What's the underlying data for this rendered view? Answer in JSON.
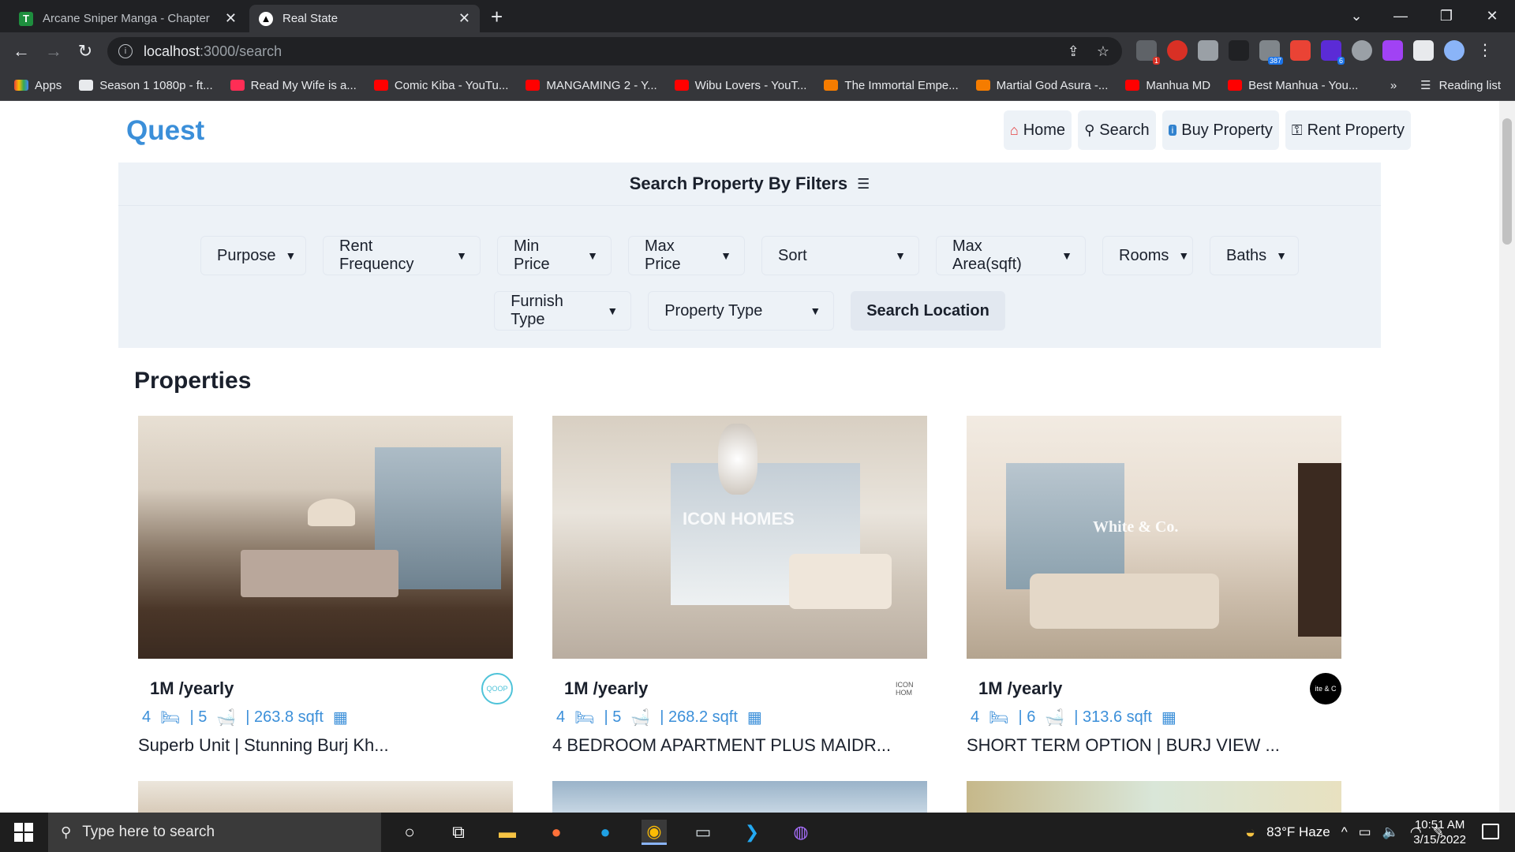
{
  "browser": {
    "tabs": [
      {
        "title": "Arcane Sniper Manga - Chapter",
        "favicon": "T",
        "active": false
      },
      {
        "title": "Real State",
        "favicon": "▲",
        "active": true
      }
    ],
    "url_host": "localhost",
    "url_path": ":3000/search",
    "bookmarks": [
      {
        "label": "Apps",
        "icon": "apps-grid"
      },
      {
        "label": "Season 1 1080p - ft...",
        "icon": "folder"
      },
      {
        "label": "Read My Wife is a...",
        "icon": "tx-logo"
      },
      {
        "label": "Comic Kiba - YouTu...",
        "icon": "youtube"
      },
      {
        "label": "MANGAMING 2 - Y...",
        "icon": "youtube"
      },
      {
        "label": "Wibu Lovers - YouT...",
        "icon": "youtube"
      },
      {
        "label": "The Immortal Empe...",
        "icon": "shield-orange"
      },
      {
        "label": "Martial God Asura -...",
        "icon": "shield-orange"
      },
      {
        "label": "Manhua MD",
        "icon": "youtube"
      },
      {
        "label": "Best Manhua - You...",
        "icon": "youtube"
      }
    ],
    "reading_list": "Reading list",
    "extension_badges": [
      "1",
      "387",
      "6"
    ]
  },
  "site": {
    "logo": "Quest",
    "nav": [
      {
        "label": "Home",
        "icon": "home-icon"
      },
      {
        "label": "Search",
        "icon": "search-icon"
      },
      {
        "label": "Buy Property",
        "icon": "info-icon"
      },
      {
        "label": "Rent Property",
        "icon": "key-icon"
      }
    ]
  },
  "filters": {
    "heading": "Search Property By Filters",
    "row1": [
      "Purpose",
      "Rent Frequency",
      "Min Price",
      "Max Price",
      "Sort",
      "Max Area(sqft)",
      "Rooms",
      "Baths"
    ],
    "row2": [
      "Furnish Type",
      "Property Type"
    ],
    "search_location": "Search Location"
  },
  "properties": {
    "title": "Properties",
    "items": [
      {
        "price": "1M /yearly",
        "rooms": "4",
        "baths": "| 5",
        "area": "| 263.8 sqft",
        "name": "Superb Unit | Stunning Burj Kh...",
        "agency": "QOOP"
      },
      {
        "price": "1M /yearly",
        "rooms": "4",
        "baths": "| 5",
        "area": "| 268.2 sqft",
        "name": "4 BEDROOM APARTMENT PLUS MAIDR...",
        "agency": "ICON HOM"
      },
      {
        "price": "1M /yearly",
        "rooms": "4",
        "baths": "| 6",
        "area": "| 313.6 sqft",
        "name": "SHORT TERM OPTION | BURJ VIEW ...",
        "agency": "ite & C"
      }
    ],
    "watermarks": [
      "",
      "ICON HOMES",
      "White & Co."
    ]
  },
  "taskbar": {
    "search_placeholder": "Type here to search",
    "weather": "83°F  Haze",
    "time": "10:51 AM",
    "date": "3/15/2022"
  },
  "colors": {
    "accent": "#3b8fd9",
    "filter_bg": "#edf2f7",
    "chrome_dark": "#202124",
    "chrome_toolbar": "#35363a"
  }
}
